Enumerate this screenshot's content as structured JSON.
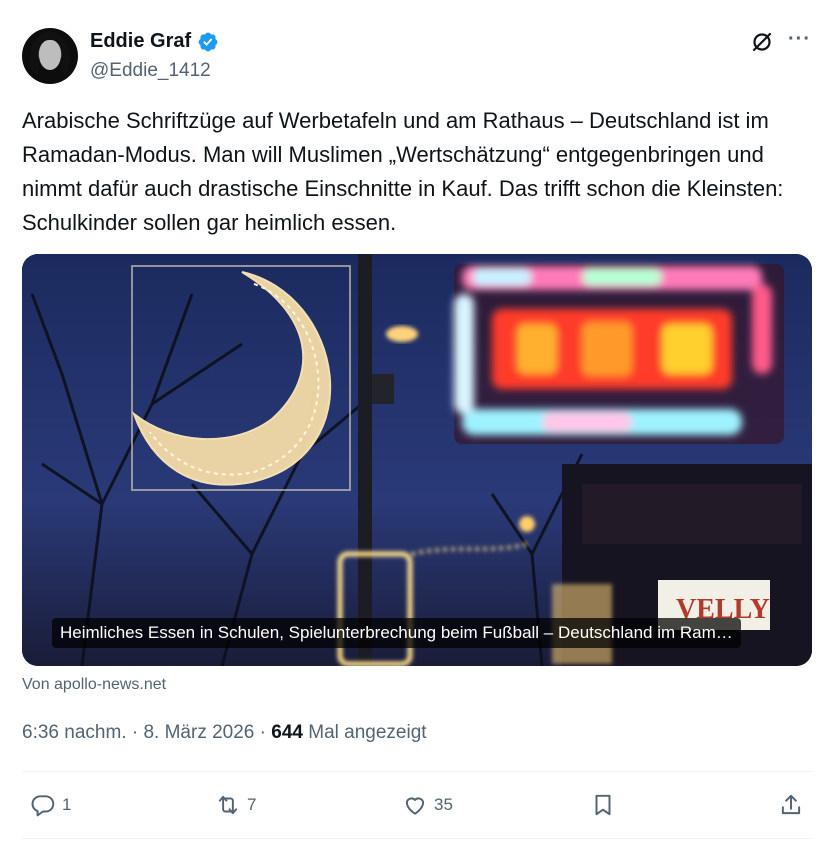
{
  "author": {
    "display_name": "Eddie Graf",
    "handle": "@Eddie_1412",
    "verified_icon": "verified-badge-icon"
  },
  "tweet": {
    "text": "Arabische Schriftzüge auf Werbetafeln und am Rathaus – Deutschland ist im Ramadan-Modus. Man will Muslimen „Wertschätzung“ entgegenbringen und nimmt dafür auch drastische Einschnitte in Kauf. Das trifft schon die Kleinsten: Schulkinder sollen gar heimlich essen."
  },
  "card": {
    "caption": "Heimliches Essen in Schulen, Spielunterbrechung beim Fußball – Deutschland im Ram…",
    "source": "Von apollo-news.net"
  },
  "meta": {
    "time": "6:36 nachm.",
    "separator": "·",
    "date": "8. März 2026",
    "views_count": "644",
    "views_label": "Mal angezeigt"
  },
  "actions": {
    "replies": "1",
    "reposts": "7",
    "likes": "35"
  },
  "colors": {
    "verified": "#1d9bf0",
    "text_primary": "#0f1419",
    "text_secondary": "#536471",
    "divider": "#eff3f4"
  }
}
